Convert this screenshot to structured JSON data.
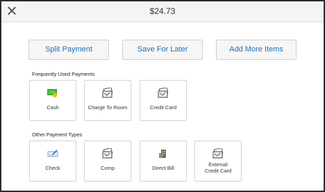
{
  "header": {
    "amount": "$24.73"
  },
  "actions": {
    "split": "Split Payment",
    "save": "Save For Later",
    "add": "Add More Items"
  },
  "sections": {
    "frequent": "Frequently Used Payments",
    "other": "Other Payment Types"
  },
  "frequent_payments": [
    {
      "label": "Cash",
      "icon": "cash-icon"
    },
    {
      "label": "Charge To Room",
      "icon": "card-icon"
    },
    {
      "label": "Credit Card",
      "icon": "card-icon"
    }
  ],
  "other_payments": [
    {
      "label": "Check",
      "icon": "check-icon"
    },
    {
      "label": "Comp",
      "icon": "card-icon"
    },
    {
      "label": "Direct Bill",
      "icon": "building-icon"
    },
    {
      "label": "External\nCredit Card",
      "icon": "card-icon"
    }
  ],
  "colors": {
    "accent": "#1f6fb5",
    "cash_green": "#3aa935",
    "cash_yellow": "#f2c200"
  }
}
